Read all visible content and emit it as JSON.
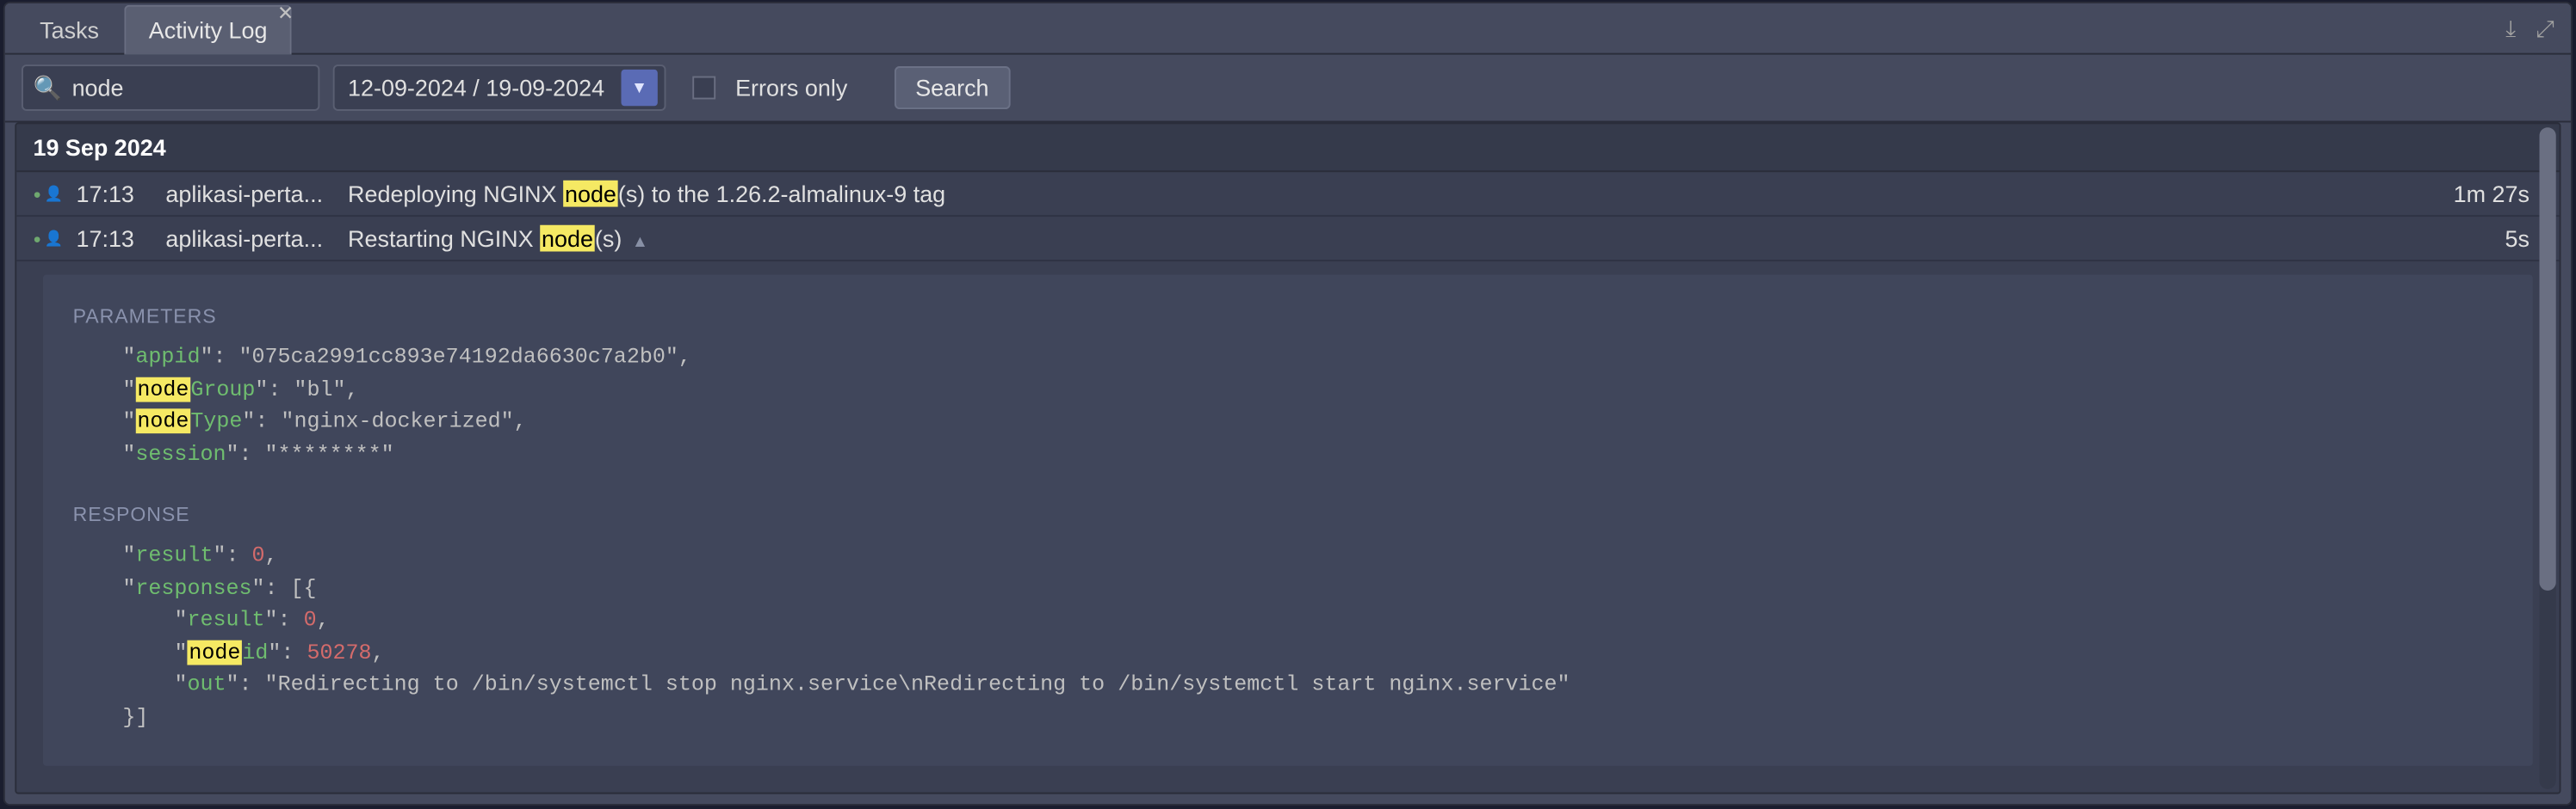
{
  "tabs": {
    "tasks": "Tasks",
    "activity_log": "Activity Log"
  },
  "filter": {
    "search_value": "node",
    "date_range": "12-09-2024 / 19-09-2024",
    "errors_only_label": "Errors only",
    "search_button": "Search"
  },
  "date_header": "19 Sep 2024",
  "rows": [
    {
      "time": "17:13",
      "env": "aplikasi-perta...",
      "msg_prefix": "Redeploying NGINX ",
      "msg_hl": "node",
      "msg_suffix": "(s) to the 1.26.2-almalinux-9 tag",
      "duration": "1m 27s"
    },
    {
      "time": "17:13",
      "env": "aplikasi-perta...",
      "msg_prefix": "Restarting NGINX ",
      "msg_hl": "node",
      "msg_suffix": "(s)",
      "duration": "5s"
    }
  ],
  "details": {
    "params_label": "PARAMETERS",
    "response_label": "RESPONSE",
    "params": {
      "appid_key": "appid",
      "appid_val": "075ca2991cc893e74192da6630c7a2b0",
      "nodegroup_key_hl": "node",
      "nodegroup_key_rest": "Group",
      "nodegroup_val": "bl",
      "nodetype_key_hl": "node",
      "nodetype_key_rest": "Type",
      "nodetype_val": "nginx-dockerized",
      "session_key": "session",
      "session_val": "********"
    },
    "response": {
      "result_key": "result",
      "result_val": "0",
      "responses_key": "responses",
      "inner_result_key": "result",
      "inner_result_val": "0",
      "nodeid_key_hl": "node",
      "nodeid_key_rest": "id",
      "nodeid_val": "50278",
      "out_key": "out",
      "out_val": "Redirecting to /bin/systemctl stop nginx.service\\nRedirecting to /bin/systemctl start nginx.service"
    }
  }
}
